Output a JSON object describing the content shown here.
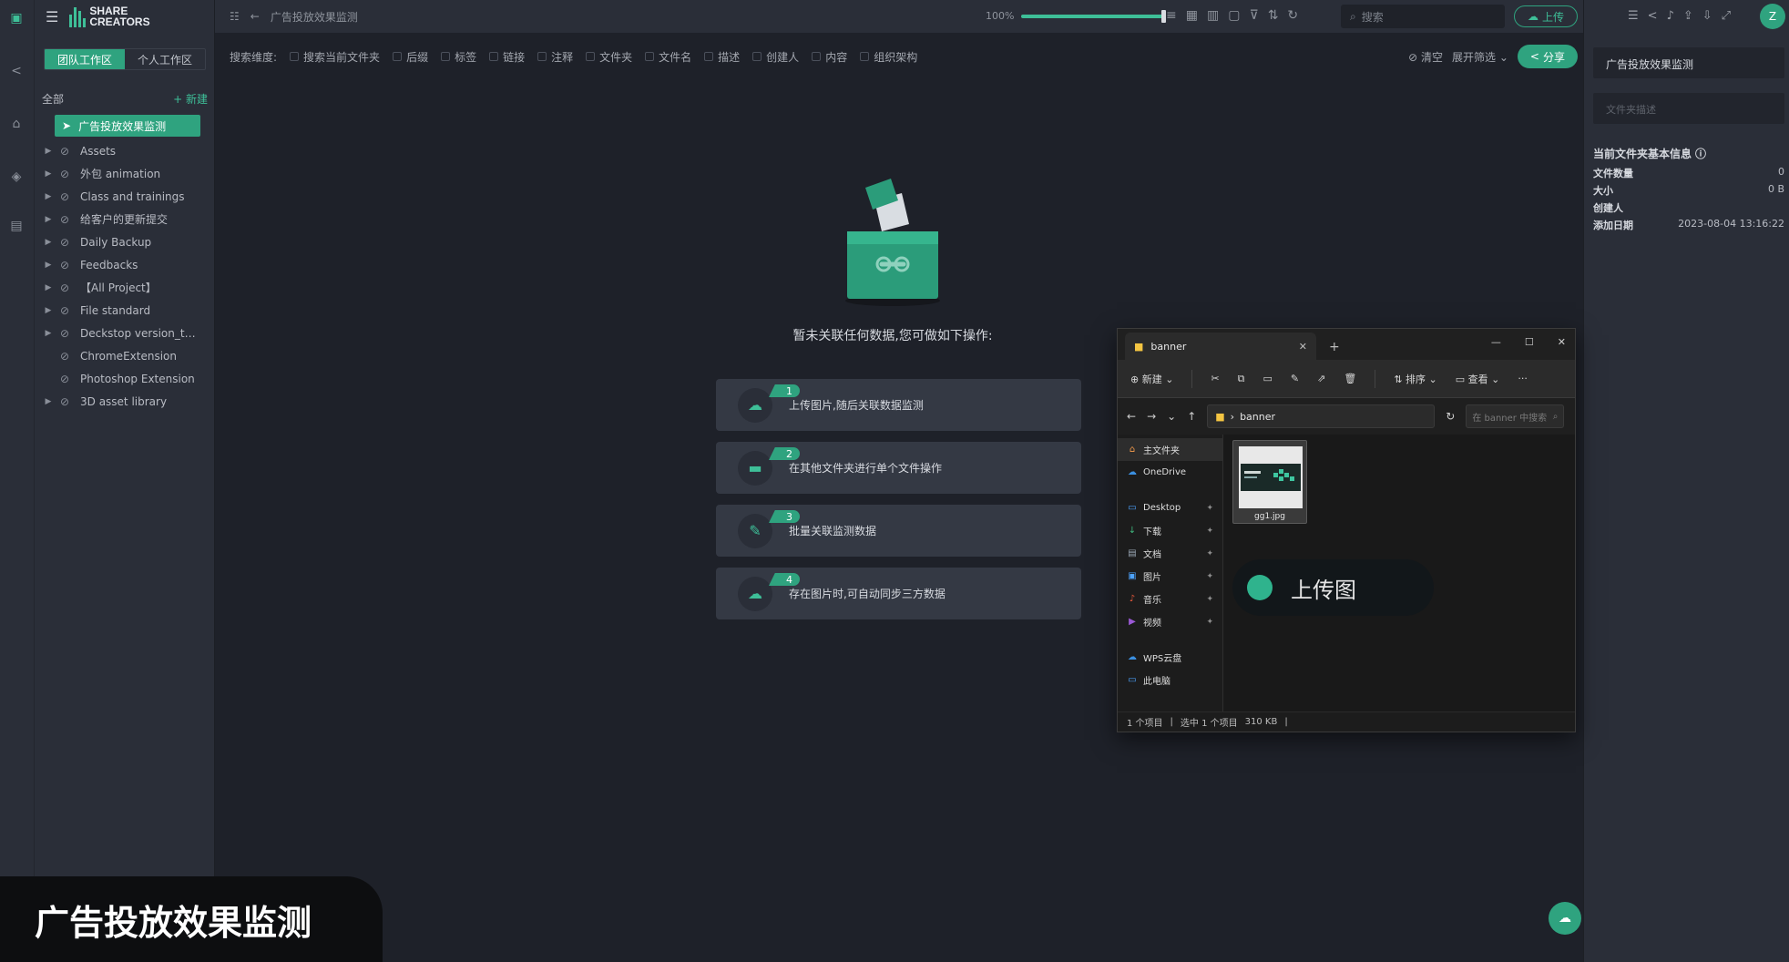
{
  "brand": {
    "name": "SHARE CREATORS"
  },
  "sidebar": {
    "tabs": [
      {
        "label": "团队工作区"
      },
      {
        "label": "个人工作区"
      }
    ],
    "all_label": "全部",
    "new_label": "+ 新建",
    "active_folder": "广告投放效果监测",
    "items": [
      {
        "label": "Assets",
        "expandable": true
      },
      {
        "label": "外包 animation",
        "expandable": true
      },
      {
        "label": "Class and trainings",
        "expandable": true
      },
      {
        "label": "给客户的更新提交",
        "expandable": true
      },
      {
        "label": "Daily Backup",
        "expandable": true
      },
      {
        "label": "Feedbacks",
        "expandable": true
      },
      {
        "label": "【All Project】",
        "expandable": true
      },
      {
        "label": "File standard",
        "expandable": true
      },
      {
        "label": "Deckstop version_tutor...",
        "expandable": true
      },
      {
        "label": "ChromeExtension",
        "expandable": false
      },
      {
        "label": "Photoshop Extension",
        "expandable": false
      },
      {
        "label": "3D asset library",
        "expandable": true
      }
    ]
  },
  "topbar": {
    "breadcrumb": "广告投放效果监测",
    "zoom": "100%",
    "zoom_level": 1.0,
    "search_placeholder": "搜索",
    "upload_label": "上传"
  },
  "filterbar": {
    "label": "搜索维度:",
    "options": [
      "搜索当前文件夹",
      "后缀",
      "标签",
      "链接",
      "注释",
      "文件夹",
      "文件名",
      "描述",
      "创建人",
      "内容",
      "组织架构"
    ],
    "clear_label": "清空",
    "expand_label": "展开筛选",
    "share_label": "分享"
  },
  "main": {
    "empty_title": "暂未关联任何数据,您可做如下操作:",
    "steps": [
      {
        "num": "1",
        "text": "上传图片,随后关联数据监测",
        "icon": "cloud-upload-icon"
      },
      {
        "num": "2",
        "text": "在其他文件夹进行单个文件操作",
        "icon": "folder-icon"
      },
      {
        "num": "3",
        "text": "批量关联监测数据",
        "icon": "document-edit-icon"
      },
      {
        "num": "4",
        "text": "存在图片时,可自动同步三方数据",
        "icon": "cloud-sync-icon"
      }
    ]
  },
  "rightpanel": {
    "folder_name": "广告投放效果监测",
    "desc_placeholder": "文件夹描述",
    "info_title": "当前文件夹基本信息",
    "info": [
      {
        "k": "文件数量",
        "v": "0"
      },
      {
        "k": "大小",
        "v": "0 B"
      },
      {
        "k": "创建人",
        "v": ""
      },
      {
        "k": "添加日期",
        "v": "2023-08-04 13:16:22"
      }
    ],
    "avatar": "Z"
  },
  "explorer": {
    "tab_title": "banner",
    "cmd": {
      "new": "新建",
      "sort": "排序",
      "view": "查看"
    },
    "path": "banner",
    "search_placeholder": "在 banner 中搜索",
    "nav": [
      {
        "label": "主文件夹",
        "icon": "home-icon",
        "pin": false,
        "sel": true
      },
      {
        "label": "OneDrive",
        "icon": "cloud-icon",
        "pin": false,
        "sel": false
      },
      {
        "label": "Desktop",
        "icon": "desktop-icon",
        "pin": true,
        "sel": false
      },
      {
        "label": "下载",
        "icon": "download-icon",
        "pin": true,
        "sel": false
      },
      {
        "label": "文档",
        "icon": "document-icon",
        "pin": true,
        "sel": false
      },
      {
        "label": "图片",
        "icon": "picture-icon",
        "pin": true,
        "sel": false
      },
      {
        "label": "音乐",
        "icon": "music-icon",
        "pin": true,
        "sel": false
      },
      {
        "label": "视频",
        "icon": "video-icon",
        "pin": true,
        "sel": false
      },
      {
        "label": "WPS云盘",
        "icon": "cloud-icon",
        "pin": false,
        "sel": false
      },
      {
        "label": "此电脑",
        "icon": "computer-icon",
        "pin": false,
        "sel": false
      }
    ],
    "file": {
      "name": "gg1.jpg"
    },
    "status": {
      "count": "1 个项目",
      "selected": "选中 1 个项目",
      "size": "310 KB"
    }
  },
  "toast": {
    "text": "上传图"
  },
  "caption": {
    "text": "广告投放效果监测"
  },
  "colors": {
    "accent": "#2fa37f",
    "bg": "#1e2129",
    "panel": "#2a2e38"
  }
}
